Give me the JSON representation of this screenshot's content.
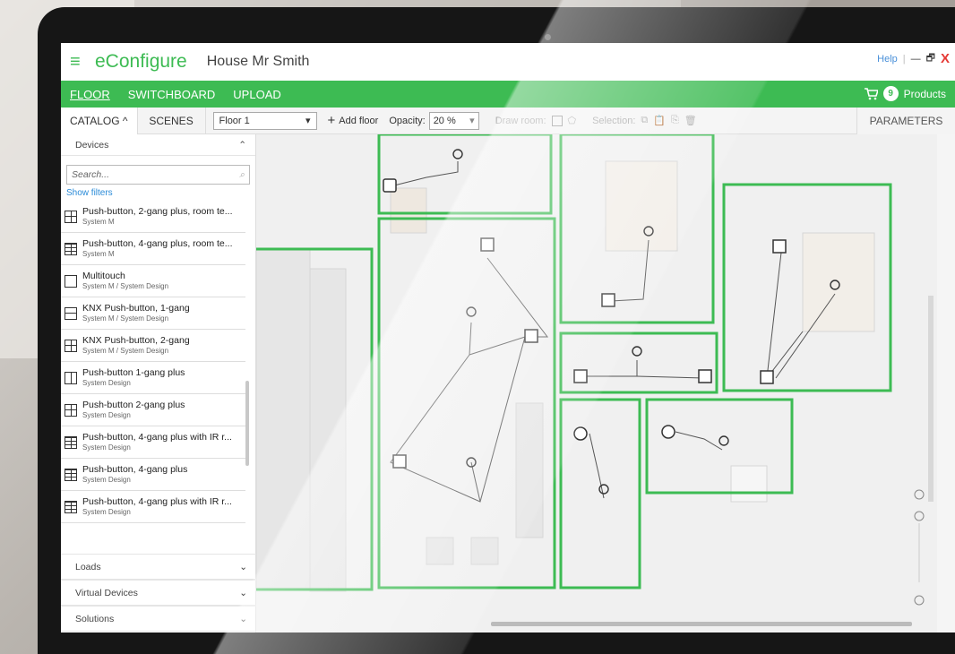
{
  "app": {
    "name": "eConfigure",
    "project": "House Mr Smith"
  },
  "window": {
    "help": "Help",
    "minimize": "—",
    "restore": "🗗",
    "close": "X"
  },
  "menu": {
    "items": [
      "FLOOR",
      "SWITCHBOARD",
      "UPLOAD"
    ],
    "active": "FLOOR",
    "cart_count": "9",
    "products": "Products"
  },
  "toolbar": {
    "catalog": "CATALOG ^",
    "scenes": "SCENES",
    "floor": "Floor 1",
    "add_floor": "Add floor",
    "opacity_label": "Opacity:",
    "opacity_value": "20 %",
    "draw_room": "Draw room:",
    "selection": "Selection:",
    "parameters": "PARAMETERS"
  },
  "sidebar": {
    "devices": "Devices",
    "search_placeholder": "Search...",
    "show_filters": "Show filters",
    "items": [
      {
        "name": "Push-button, 2-gang plus, room te...",
        "sub": "System M"
      },
      {
        "name": "Push-button, 4-gang plus, room te...",
        "sub": "System M"
      },
      {
        "name": "Multitouch",
        "sub": "System M / System Design"
      },
      {
        "name": "KNX Push-button, 1-gang",
        "sub": "System M / System Design"
      },
      {
        "name": "KNX Push-button, 2-gang",
        "sub": "System M / System Design"
      },
      {
        "name": "Push-button 1-gang plus",
        "sub": "System Design"
      },
      {
        "name": "Push-button 2-gang plus",
        "sub": "System Design"
      },
      {
        "name": "Push-button, 4-gang plus with IR r...",
        "sub": "System Design"
      },
      {
        "name": "Push-button, 4-gang plus",
        "sub": "System Design"
      },
      {
        "name": "Push-button, 4-gang plus with IR r...",
        "sub": "System Design"
      }
    ],
    "sections": [
      "Loads",
      "Virtual Devices",
      "Solutions"
    ]
  },
  "colors": {
    "brand": "#3dbb53",
    "room_outline": "#3dbb53",
    "close": "#e53935"
  }
}
